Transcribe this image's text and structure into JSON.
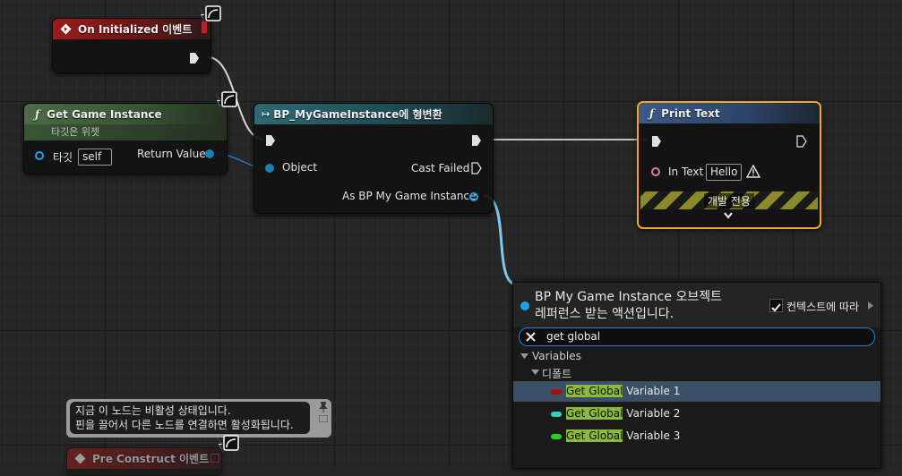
{
  "nodes": {
    "on_initialized": {
      "title": "On Initialized 이벤트"
    },
    "get_game_instance": {
      "title": "Get Game Instance",
      "subtitle": "타깃은 위젯",
      "target_label": "타깃",
      "target_value": "self",
      "return_label": "Return Value"
    },
    "cast": {
      "title": "BP_MyGameInstance에 형변환",
      "object_label": "Object",
      "cast_failed_label": "Cast Failed",
      "as_label": "As BP My Game Instance"
    },
    "print_text": {
      "title": "Print Text",
      "in_text_label": "In Text",
      "in_text_value": "Hello",
      "dev_only_label": "개발 전용"
    },
    "pre_construct": {
      "title": "Pre Construct 이벤트"
    }
  },
  "comment": {
    "line1": "지금 이 노드는 비활성 상태입니다.",
    "line2": "핀을 끌어서 다른 노드를 연결하면 활성화됩니다."
  },
  "context_menu": {
    "title_line1": "BP My Game Instance 오브젝트",
    "title_line2": "레퍼런스 받는 액션입니다.",
    "context_sensitive_label": "컨텍스트에 따라",
    "context_sensitive_checked": true,
    "search_value": "get global",
    "category": "Variables",
    "subcategory": "디폴트",
    "items": [
      {
        "highlight": "Get Global",
        "rest": " Variable 1",
        "color": "#a01010"
      },
      {
        "highlight": "Get Global",
        "rest": " Variable 2",
        "color": "#2fd3b8"
      },
      {
        "highlight": "Get Global",
        "rest": " Variable 3",
        "color": "#22cc22"
      }
    ]
  },
  "colors": {
    "event_header": "#9a1d1d",
    "pure_function_header": "#4c6b46",
    "cast_header": "#2c6a74",
    "function_header": "#3c5a88",
    "object_pin": "#1aa3e8",
    "selection": "#f5a623"
  }
}
